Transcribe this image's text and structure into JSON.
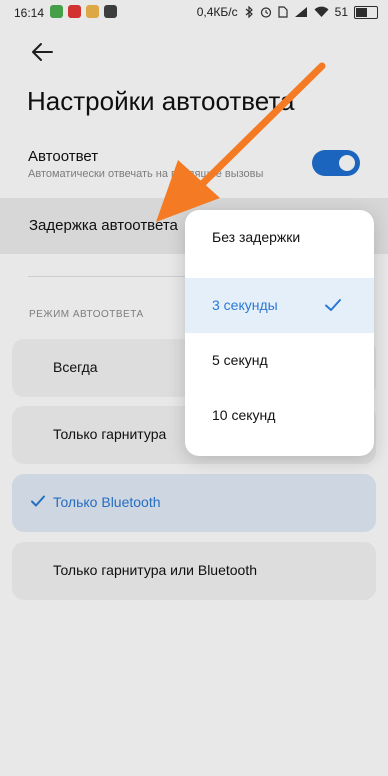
{
  "status_bar": {
    "time": "16:14",
    "network_speed": "0,4КБ/с",
    "battery_percent": "51",
    "battery_level": 0.51,
    "left_icons": [
      "maps-icon",
      "youtube-icon",
      "gallery-icon",
      "app-icon"
    ],
    "right_icons": [
      "bluetooth-icon",
      "alarm-icon",
      "sim-icon",
      "signal-icon",
      "wifi-icon"
    ]
  },
  "header": {
    "title": "Настройки автоответа"
  },
  "autoreply": {
    "title": "Автоответ",
    "subtitle": "Автоматически отвечать на входящие вызовы",
    "enabled": true
  },
  "delay": {
    "title": "Задержка автоответа"
  },
  "mode_section": {
    "label": "РЕЖИМ АВТООТВЕТА",
    "options": [
      {
        "label": "Всегда",
        "selected": false
      },
      {
        "label": "Только гарнитура",
        "selected": false
      },
      {
        "label": "Только Bluetooth",
        "selected": true
      },
      {
        "label": "Только гарнитура или Bluetooth",
        "selected": false
      }
    ]
  },
  "delay_popup": {
    "options": [
      {
        "label": "Без задержки",
        "selected": false
      },
      {
        "label": "3 секунды",
        "selected": true
      },
      {
        "label": "5 секунд",
        "selected": false
      },
      {
        "label": "10 секунд",
        "selected": false
      }
    ]
  },
  "colors": {
    "accent": "#2a78d6",
    "toggle_on": "#1f6fd1",
    "annotation_arrow": "#f47a24"
  }
}
